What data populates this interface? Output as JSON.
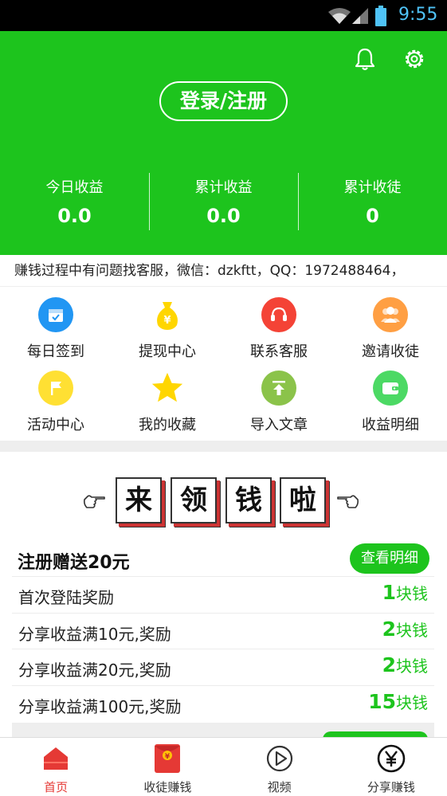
{
  "status_bar": {
    "time": "9:55"
  },
  "header": {
    "login_label": "登录/注册",
    "stats": [
      {
        "label": "今日收益",
        "value": "0.0"
      },
      {
        "label": "累计收益",
        "value": "0.0"
      },
      {
        "label": "累计收徒",
        "value": "0"
      }
    ]
  },
  "notice": {
    "text": "赚钱过程中有问题找客服，微信：dzkftt，QQ：1972488464，"
  },
  "grid": {
    "items": [
      {
        "label": "每日签到",
        "icon": "calendar-icon",
        "color": "#2196f3"
      },
      {
        "label": "提现中心",
        "icon": "money-bag-icon",
        "color": "#ffd600"
      },
      {
        "label": "联系客服",
        "icon": "headset-icon",
        "color": "#f44336"
      },
      {
        "label": "邀请收徒",
        "icon": "people-icon",
        "color": "#ff9f43"
      },
      {
        "label": "活动中心",
        "icon": "flag-icon",
        "color": "#ffe033"
      },
      {
        "label": "我的收藏",
        "icon": "star-icon",
        "color": "#ffd600"
      },
      {
        "label": "导入文章",
        "icon": "upload-icon",
        "color": "#8bc34a"
      },
      {
        "label": "收益明细",
        "icon": "wallet-icon",
        "color": "#4cd964"
      }
    ]
  },
  "banner": {
    "chars": [
      "来",
      "领",
      "钱",
      "啦"
    ]
  },
  "rewards": {
    "title": "注册赠送20元",
    "detail_label": "查看明细",
    "unit": "块钱",
    "rows": [
      {
        "label": "首次登陆奖励",
        "amount": "1"
      },
      {
        "label": "分享收益满10元,奖励",
        "amount": "2"
      },
      {
        "label": "分享收益满20元,奖励",
        "amount": "2"
      },
      {
        "label": "分享收益满100元,奖励",
        "amount": "15"
      }
    ]
  },
  "tabbar": {
    "tabs": [
      {
        "label": "首页",
        "icon": "home-icon"
      },
      {
        "label": "收徒赚钱",
        "icon": "red-envelope-icon"
      },
      {
        "label": "视频",
        "icon": "play-icon"
      },
      {
        "label": "分享赚钱",
        "icon": "yen-coin-icon"
      }
    ]
  },
  "colors": {
    "brand_green": "#1dc41d",
    "active_red": "#e53935",
    "status_blue": "#4fc3f7"
  }
}
